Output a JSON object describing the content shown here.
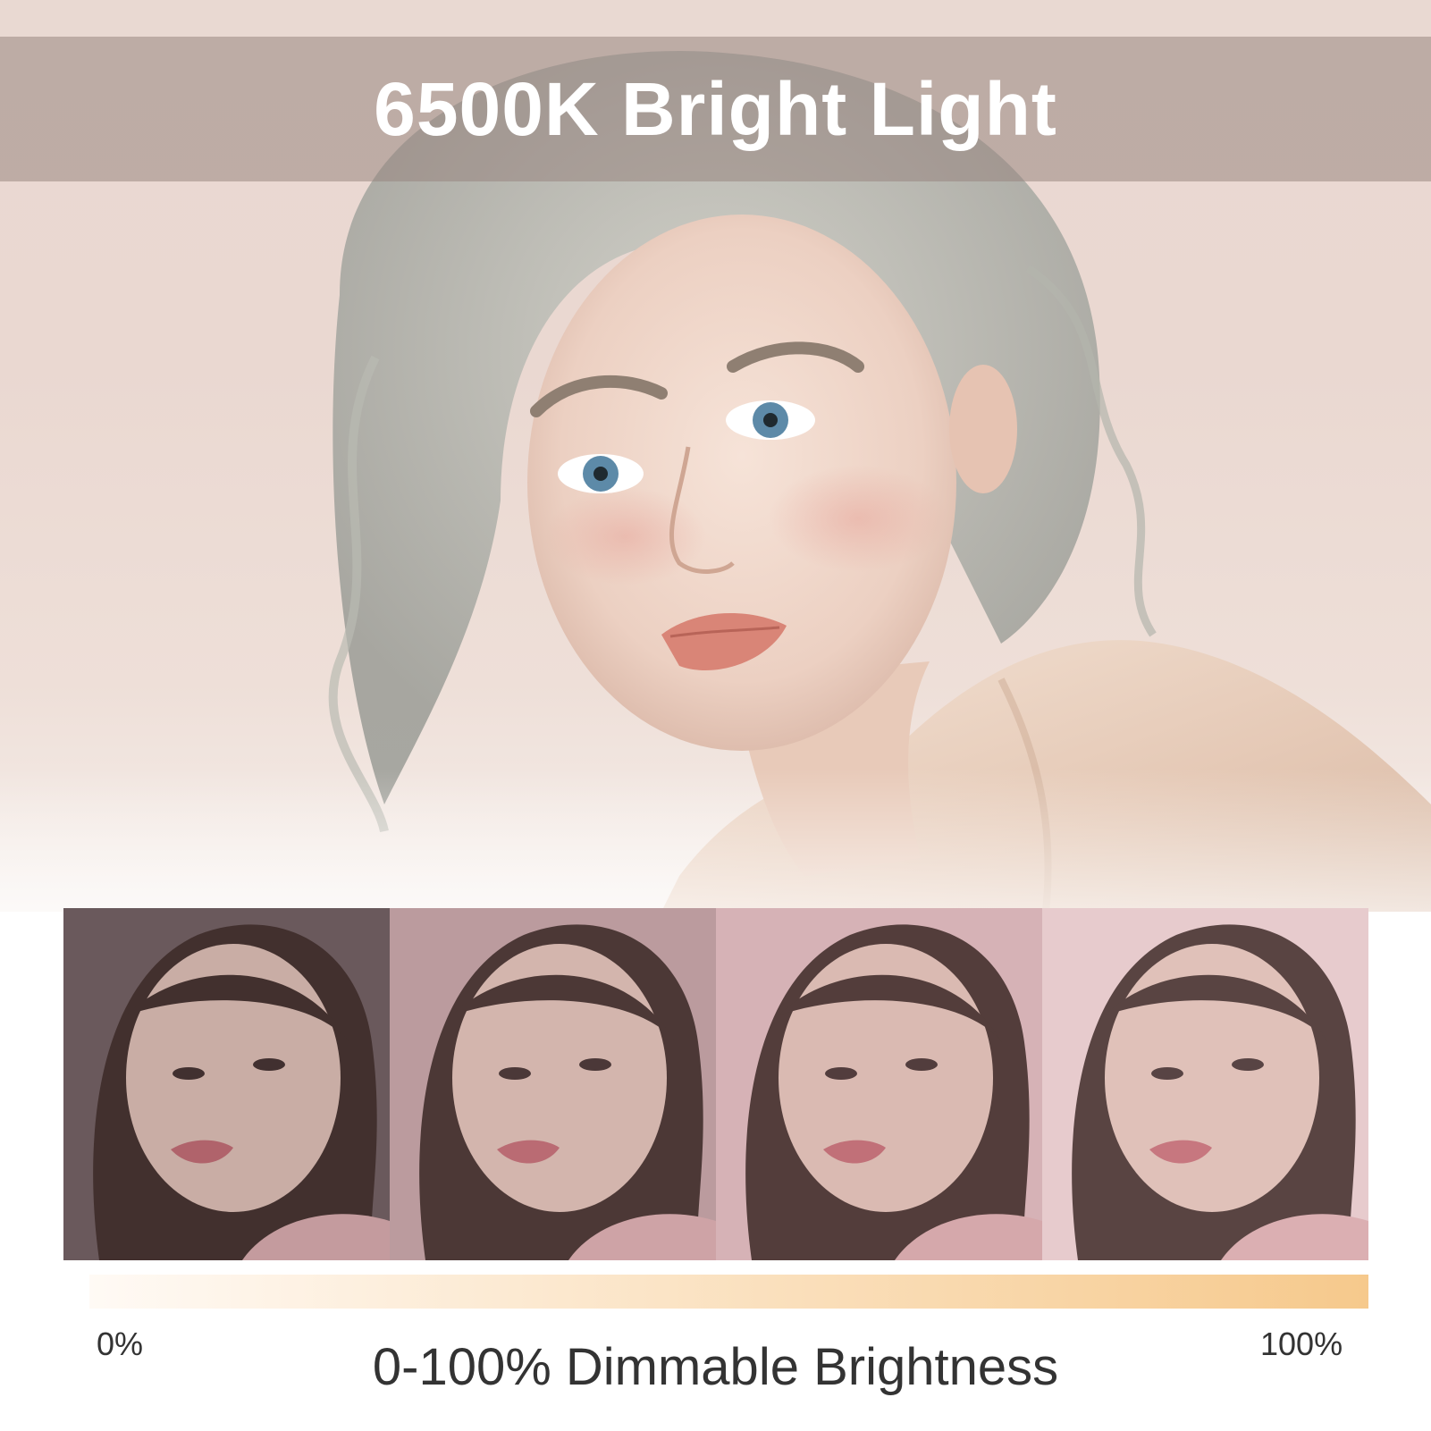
{
  "header": {
    "title": "6500K Bright Light"
  },
  "scale": {
    "min_label": "0%",
    "max_label": "100%"
  },
  "caption": "0-100% Dimmable Brightness",
  "brightness_panels": [
    {
      "tint": "#6f5e60",
      "shade": "#5a4a4c"
    },
    {
      "tint": "#c9a8ab",
      "shade": "#8a6f70"
    },
    {
      "tint": "#e3bfc3",
      "shade": "#a7868a"
    },
    {
      "tint": "#f1d6d8",
      "shade": "#c5a5a8"
    }
  ],
  "colors": {
    "bar_start": "#fffaf5",
    "bar_end": "#f6c98c",
    "text": "#333333"
  }
}
